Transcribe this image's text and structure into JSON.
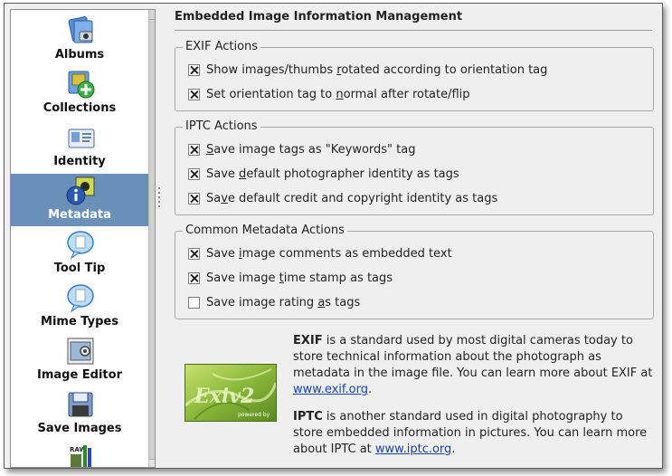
{
  "sidebar": {
    "items": [
      {
        "label": "Albums",
        "icon": "albums-icon",
        "selected": false
      },
      {
        "label": "Collections",
        "icon": "collections-icon",
        "selected": false
      },
      {
        "label": "Identity",
        "icon": "identity-icon",
        "selected": false
      },
      {
        "label": "Metadata",
        "icon": "metadata-icon",
        "selected": true
      },
      {
        "label": "Tool Tip",
        "icon": "tooltip-icon",
        "selected": false
      },
      {
        "label": "Mime Types",
        "icon": "mime-types-icon",
        "selected": false
      },
      {
        "label": "Image Editor",
        "icon": "image-editor-icon",
        "selected": false
      },
      {
        "label": "Save Images",
        "icon": "save-images-icon",
        "selected": false
      },
      {
        "label": "",
        "icon": "raw-decoding-icon",
        "selected": false
      }
    ],
    "selected_color": "#6a8fb8"
  },
  "page": {
    "title": "Embedded Image Information Management"
  },
  "exif_actions": {
    "title": "EXIF Actions",
    "options": [
      {
        "pre": "Show images/thumbs ",
        "u": "r",
        "post": "otated according to orientation tag",
        "checked": true
      },
      {
        "pre": "Set orientation tag to ",
        "u": "n",
        "post": "ormal after rotate/flip",
        "checked": true
      }
    ]
  },
  "iptc_actions": {
    "title": "IPTC Actions",
    "options": [
      {
        "pre": "",
        "u": "S",
        "post": "ave image tags as \"Keywords\" tag",
        "checked": true
      },
      {
        "pre": "Save ",
        "u": "d",
        "post": "efault photographer identity as tags",
        "checked": true
      },
      {
        "pre": "Sa",
        "u": "v",
        "post": "e default credit and copyright identity as tags",
        "checked": true
      }
    ]
  },
  "common_actions": {
    "title": "Common Metadata Actions",
    "options": [
      {
        "pre": "Save ",
        "u": "i",
        "post": "mage comments as embedded text",
        "checked": true
      },
      {
        "pre": "Save image ",
        "u": "t",
        "post": "ime stamp as tags",
        "checked": true
      },
      {
        "pre": "Save image rating ",
        "u": "a",
        "post": "s tags",
        "checked": false
      }
    ]
  },
  "logo": {
    "text": "Exiv2",
    "caption": "powered by"
  },
  "info": {
    "exif_name": "EXIF",
    "exif_text": " is a standard used by most digital cameras today to store technical information about the photograph as metadata in the image file. You can learn more about EXIF at ",
    "exif_link": "www.exif.org",
    "exif_end": ".",
    "iptc_name": "IPTC",
    "iptc_text": " is another standard used in digital photography to store embedded information in pictures. You can learn more about IPTC at ",
    "iptc_link": "www.iptc.org",
    "iptc_end": "."
  }
}
